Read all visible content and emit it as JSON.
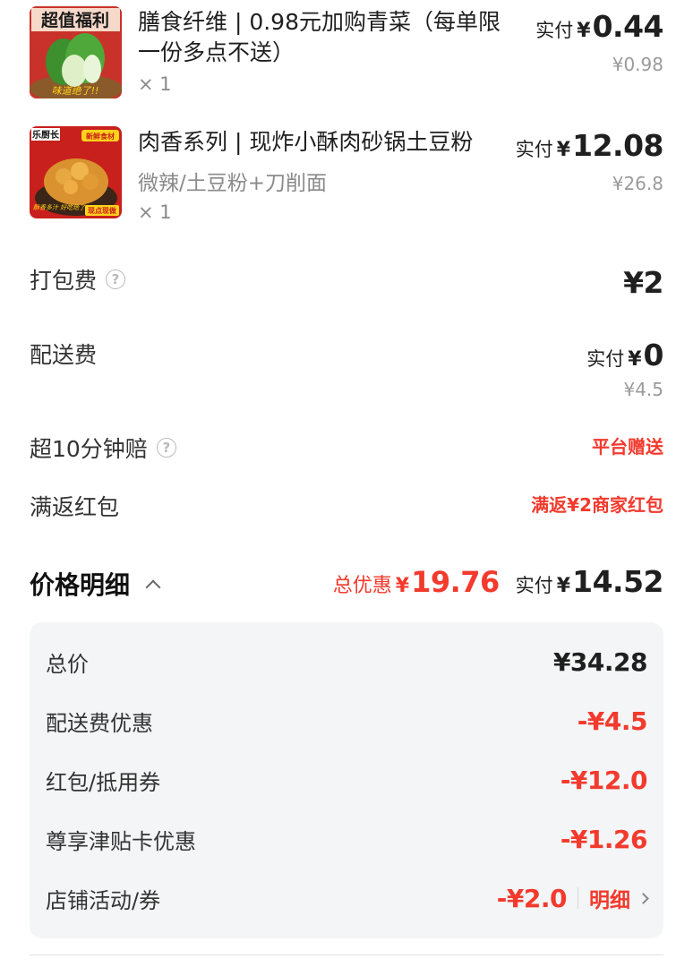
{
  "items": [
    {
      "name": "膳食纤维 | 0.98元加购青菜（每单限一份多点不送）",
      "spec": "",
      "qty": "× 1",
      "paid_label": "实付",
      "paid_yen": "¥",
      "paid_value": "0.44",
      "original": "¥0.98",
      "thumb_text_top": "超值福利",
      "thumb_text_bottom": "味道绝了!!"
    },
    {
      "name": "肉香系列 | 现炸小酥肉砂锅土豆粉",
      "spec": "微辣/土豆粉+刀削面",
      "qty": "× 1",
      "paid_label": "实付",
      "paid_yen": "¥",
      "paid_value": "12.08",
      "original": "¥26.8",
      "thumb_text_tl": "乐厨长",
      "thumb_text_tr": "新鲜食材",
      "thumb_text_bl": "酥香多汁 好吃绝了!!",
      "thumb_text_br": "现点现做"
    }
  ],
  "fees": {
    "packing_label": "打包费",
    "packing_help": "?",
    "packing_value": "¥2",
    "delivery_label": "配送费",
    "delivery_paid_label": "实付",
    "delivery_paid_yen": "¥",
    "delivery_paid_value": "0",
    "delivery_original": "¥4.5",
    "late_label": "超10分钟赔",
    "late_help": "?",
    "late_value": "平台赠送",
    "redpacket_label": "满返红包",
    "redpacket_value": "满返¥2商家红包"
  },
  "price_detail": {
    "title": "价格明细",
    "discount_label": "总优惠",
    "discount_yen": "¥",
    "discount_value": "19.76",
    "paid_label": "实付",
    "paid_yen": "¥",
    "paid_value": "14.52",
    "rows": [
      {
        "label": "总价",
        "value": "¥34.28"
      },
      {
        "label": "配送费优惠",
        "value": "-¥4.5"
      },
      {
        "label": "红包/抵用券",
        "value": "-¥12.0"
      },
      {
        "label": "尊享津贴卡优惠",
        "value": "-¥1.26"
      },
      {
        "label": "店铺活动/券",
        "value": "-¥2.0",
        "link": "明细"
      }
    ]
  },
  "colors": {
    "accent_red": "#f23a2d",
    "panel_bg": "#f4f5f7",
    "muted_text": "#8a8a8a"
  }
}
